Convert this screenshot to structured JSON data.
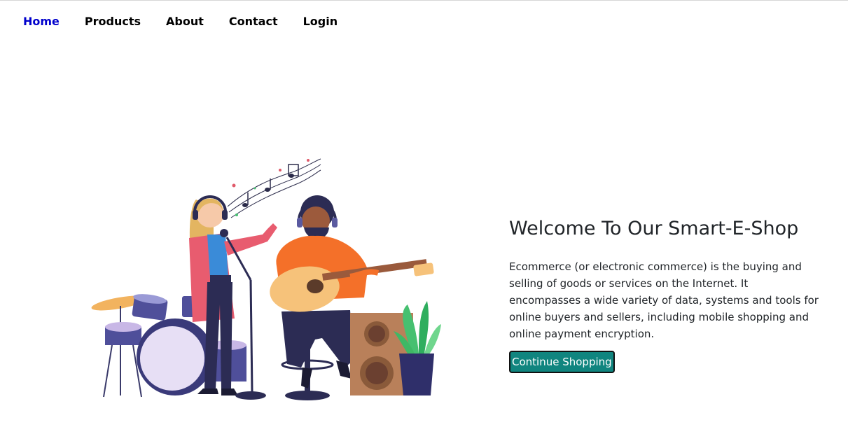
{
  "nav": {
    "items": [
      {
        "label": "Home",
        "active": true
      },
      {
        "label": "Products",
        "active": false
      },
      {
        "label": "About",
        "active": false
      },
      {
        "label": "Contact",
        "active": false
      },
      {
        "label": "Login",
        "active": false
      }
    ]
  },
  "hero": {
    "title": "Welcome To Our Smart-E-Shop",
    "description": "Ecommerce (or electronic commerce) is the buying and selling of goods or services on the Internet. It encompasses a wide variety of data, systems and tools for online buyers and sellers, including mobile shopping and online payment encryption.",
    "button_label": "Continue Shopping"
  },
  "illustration": {
    "subject": "band-music-illustration"
  },
  "colors": {
    "active_link": "#0000cc",
    "button_bg": "#10857f",
    "text": "#212529"
  }
}
